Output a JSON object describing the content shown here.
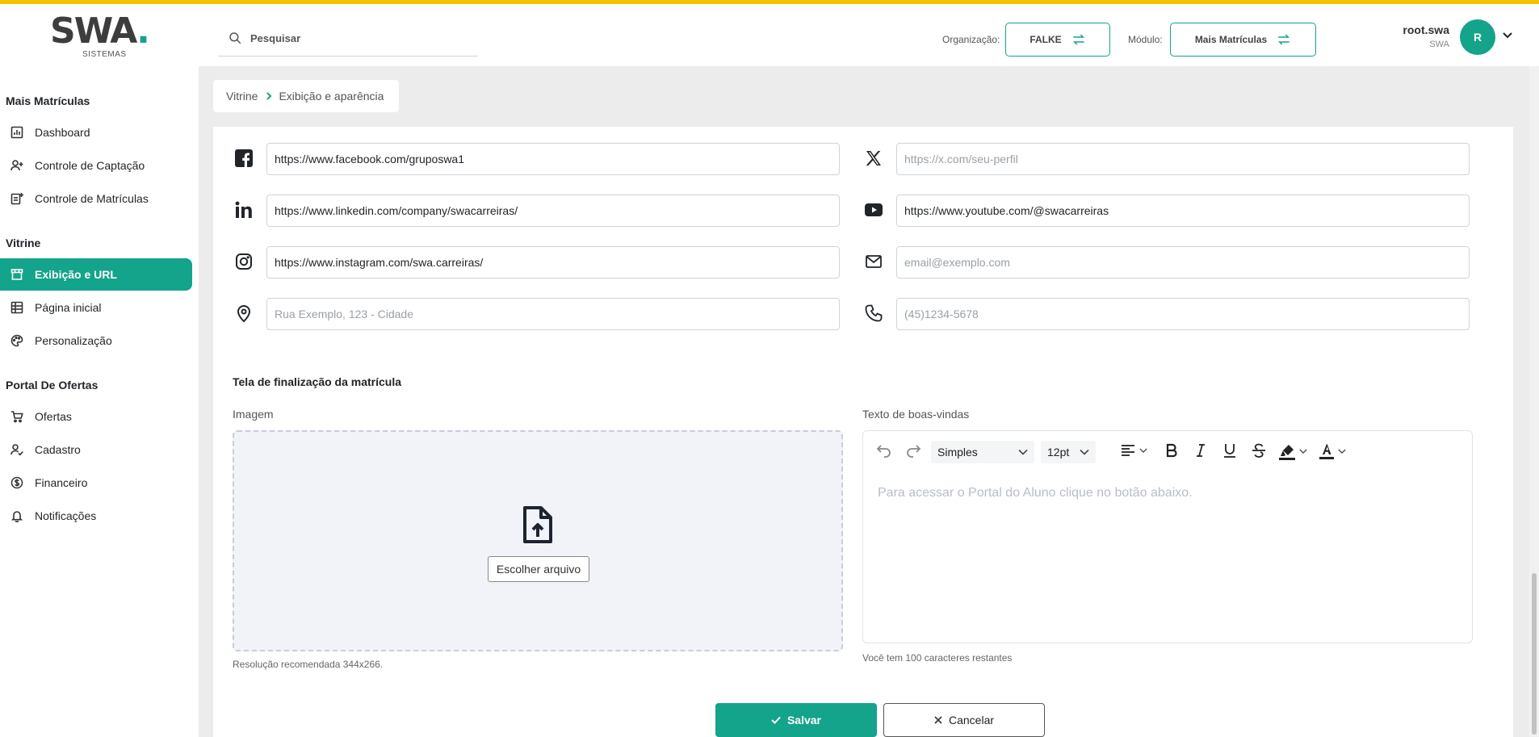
{
  "brand": {
    "logo_main": "SWA",
    "logo_dot": ".",
    "logo_sub": "SISTEMAS",
    "accent": "#14a38b",
    "top_strip": "#f5c400"
  },
  "header": {
    "search_placeholder": "Pesquisar",
    "org_label": "Organização:",
    "org_value": "FALKE",
    "module_label": "Módulo:",
    "module_value": "Mais Matrículas",
    "user_name": "root.swa",
    "user_org": "SWA",
    "avatar_letter": "R"
  },
  "sidebar": {
    "sections": [
      {
        "title": "Mais Matrículas",
        "items": [
          "Dashboard",
          "Controle de Captação",
          "Controle de Matrículas"
        ]
      },
      {
        "title": "Vitrine",
        "items": [
          "Exibição e URL",
          "Página inicial",
          "Personalização"
        ]
      },
      {
        "title": "Portal De Ofertas",
        "items": [
          "Ofertas",
          "Cadastro",
          "Financeiro",
          "Notificações"
        ]
      }
    ],
    "active_item": "Exibição e URL"
  },
  "breadcrumb": {
    "parent": "Vitrine",
    "current": "Exibição e aparência"
  },
  "social": {
    "facebook": {
      "value": "https://www.facebook.com/gruposwa1",
      "placeholder": ""
    },
    "x": {
      "value": "",
      "placeholder": "https://x.com/seu-perfil"
    },
    "linkedin": {
      "value": "https://www.linkedin.com/company/swacarreiras/",
      "placeholder": ""
    },
    "youtube": {
      "value": "https://www.youtube.com/@swacarreiras",
      "placeholder": ""
    },
    "instagram": {
      "value": "https://www.instagram.com/swa.carreiras/",
      "placeholder": ""
    },
    "email": {
      "value": "",
      "placeholder": "email@exemplo.com"
    },
    "address": {
      "value": "",
      "placeholder": "Rua Exemplo, 123 - Cidade"
    },
    "phone": {
      "value": "",
      "placeholder": "(45)1234-5678"
    }
  },
  "finalization": {
    "section_title": "Tela de finalização da matrícula",
    "image_label": "Imagem",
    "choose_file": "Escolher arquivo",
    "resolution_hint": "Resolução recomendada 344x266.",
    "welcome_label": "Texto de boas-vindas",
    "font_family": "Simples",
    "font_size": "12pt",
    "editor_placeholder": "Para acessar o Portal do Aluno clique no botão abaixo.",
    "chars_remaining": "Você tem 100 caracteres restantes"
  },
  "actions": {
    "save": "Salvar",
    "cancel": "Cancelar"
  }
}
